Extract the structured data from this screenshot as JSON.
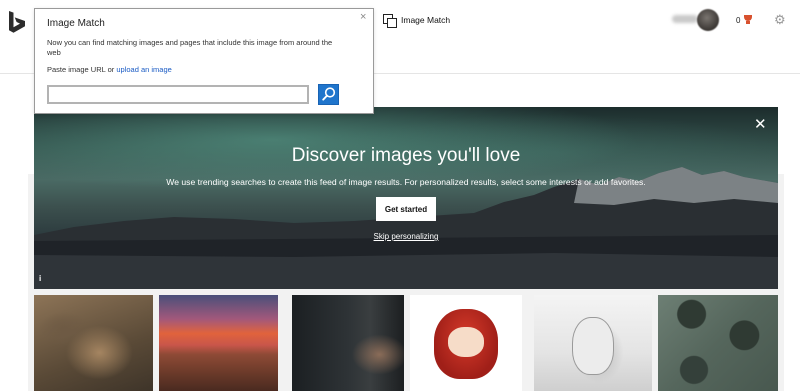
{
  "topbar": {
    "image_match_label": "Image Match",
    "points": "0"
  },
  "popover": {
    "title": "Image Match",
    "description": "Now you can find matching images and pages that include this image from around the web",
    "paste_text": "Paste image URL or",
    "upload_link": "upload an image",
    "input_value": "",
    "close_icon": "×"
  },
  "hero": {
    "title": "Discover images you'll love",
    "subtitle": "We use trending searches to create this feed of image results. For personalized results, select some interests or add favorites.",
    "cta_label": "Get started",
    "skip_label": "Skip personalizing",
    "info_label": "i",
    "close_icon": "✕"
  },
  "thumbnails": [
    {
      "subject": "quokka"
    },
    {
      "subject": "canyon-sunset"
    },
    {
      "subject": "man-portrait"
    },
    {
      "subject": "anime-chibi-red-hair"
    },
    {
      "subject": "woman-bw-portrait"
    },
    {
      "subject": "mars-surface"
    }
  ],
  "icons": {
    "logo": "bing-logo-icon",
    "image_match": "image-match-icon",
    "search": "search-icon",
    "settings": "gear-icon",
    "rewards": "trophy-icon"
  },
  "colors": {
    "accent": "#1f75cc",
    "link": "#1a5bc4",
    "logo": "#2c2c2c"
  }
}
